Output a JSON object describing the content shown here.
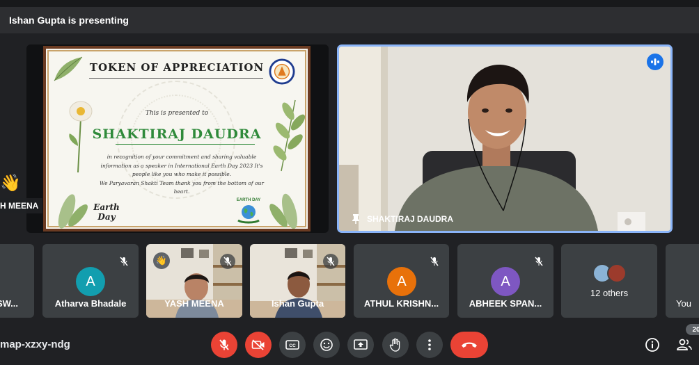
{
  "banner": {
    "presenting_text": "Ishan Gupta is presenting"
  },
  "presentation": {
    "certificate": {
      "title": "TOKEN OF APPRECIATION",
      "presented_to": "This is presented to",
      "recipient": "SHAKTIRAJ DAUDRA",
      "body_lines": [
        "in recognition of your commitment and sharing valuable",
        "information as a speaker in International Earth Day 2023 It's",
        "people like you who make it possible.",
        "We Paryavaran Shakti Team thank you from the bottom of our",
        "heart."
      ],
      "earth_day_left": "Earth Day",
      "earth_day_right": "EARTH DAY"
    }
  },
  "left_overflow": {
    "reaction": "👋",
    "name": "H MEENA"
  },
  "main_speaker": {
    "name": "SHAKTIRAJ DAUDRA"
  },
  "participants": [
    {
      "name": "SW...",
      "kind": "clipped"
    },
    {
      "name": "Atharva Bhadale",
      "initial": "A",
      "color": "#129eaf",
      "muted": true
    },
    {
      "name": "YASH MEENA",
      "kind": "video",
      "muted": true,
      "hand": "👋"
    },
    {
      "name": "Ishan Gupta",
      "kind": "video",
      "muted": true
    },
    {
      "name": "ATHUL KRISHN...",
      "initial": "A",
      "color": "#e8710a",
      "muted": true
    },
    {
      "name": "ABHEEK SPAN...",
      "initial": "A",
      "color": "#7e57c2",
      "muted": true
    },
    {
      "name": "12 others",
      "kind": "others"
    },
    {
      "name": "You",
      "kind": "self"
    }
  ],
  "controls": {
    "meeting_code": "map-xzxy-ndg",
    "participant_count": "20",
    "icons": [
      "mic-off-icon",
      "camera-off-icon",
      "captions-icon",
      "emoji-icon",
      "present-icon",
      "raise-hand-icon",
      "more-icon",
      "hang-up-icon",
      "info-icon",
      "people-icon"
    ]
  }
}
